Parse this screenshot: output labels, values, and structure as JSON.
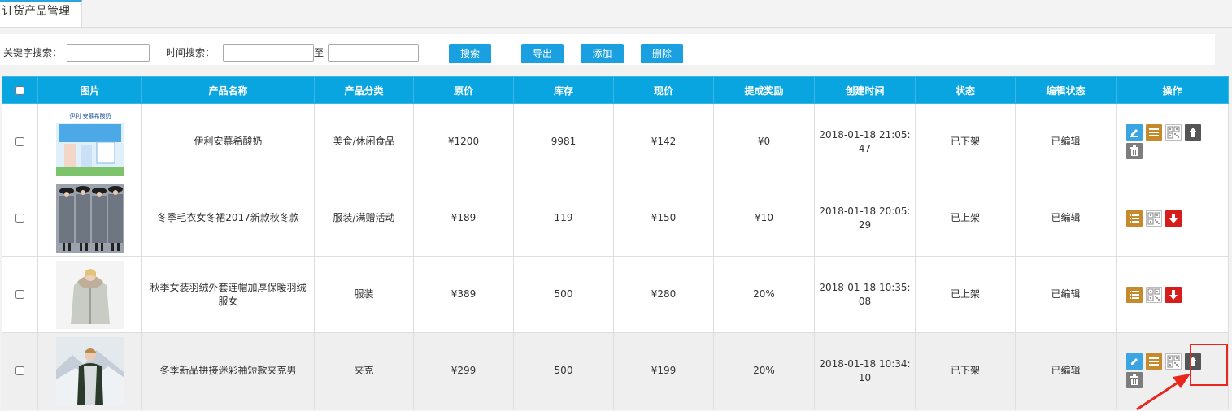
{
  "tab": {
    "title": "订货产品管理"
  },
  "search": {
    "keyword_label": "关键字搜索：",
    "keyword_value": "",
    "time_label": "时间搜索：",
    "time_from": "",
    "to_label": "至",
    "time_to": "",
    "search_button": "搜索",
    "export_button": "导出",
    "add_button": "添加",
    "delete_button": "删除"
  },
  "table": {
    "headers": {
      "image": "图片",
      "name": "产品名称",
      "category": "产品分类",
      "original_price": "原价",
      "stock": "库存",
      "current_price": "现价",
      "commission": "提成奖励",
      "created": "创建时间",
      "status": "状态",
      "edit_status": "编辑状态",
      "actions": "操作"
    },
    "rows": [
      {
        "name": "伊利安慕希酸奶",
        "category": "美食/休闲食品",
        "original_price": "¥1200",
        "stock": "9981",
        "current_price": "¥142",
        "commission": "¥0",
        "created": "2018-01-18 21:05:47",
        "status": "已下架",
        "edit_status": "已编辑",
        "actions": [
          "edit-icon",
          "list-icon",
          "qr-code-icon",
          "arrow-up-icon",
          "trash-icon"
        ],
        "thumb_banner": "伊利 安慕希酸奶"
      },
      {
        "name": "冬季毛衣女冬裙2017新款秋冬款",
        "category": "服装/满赠活动",
        "original_price": "¥189",
        "stock": "119",
        "current_price": "¥150",
        "commission": "¥10",
        "created": "2018-01-18 20:05:29",
        "status": "已上架",
        "edit_status": "已编辑",
        "actions": [
          "list-icon",
          "qr-code-icon",
          "arrow-down-icon"
        ]
      },
      {
        "name": "秋季女装羽绒外套连帽加厚保暖羽绒服女",
        "category": "服装",
        "original_price": "¥389",
        "stock": "500",
        "current_price": "¥280",
        "commission": "20%",
        "created": "2018-01-18 10:35:08",
        "status": "已上架",
        "edit_status": "已编辑",
        "actions": [
          "list-icon",
          "qr-code-icon",
          "arrow-down-icon"
        ]
      },
      {
        "name": "冬季新品拼接迷彩袖短款夹克男",
        "category": "夹克",
        "original_price": "¥299",
        "stock": "500",
        "current_price": "¥199",
        "commission": "20%",
        "created": "2018-01-18 10:34:10",
        "status": "已下架",
        "edit_status": "已编辑",
        "actions": [
          "edit-icon",
          "list-icon",
          "qr-code-icon",
          "arrow-up-icon",
          "trash-icon"
        ]
      }
    ]
  },
  "colors": {
    "accent": "#09a5e0",
    "highlight": "#e8271e"
  }
}
